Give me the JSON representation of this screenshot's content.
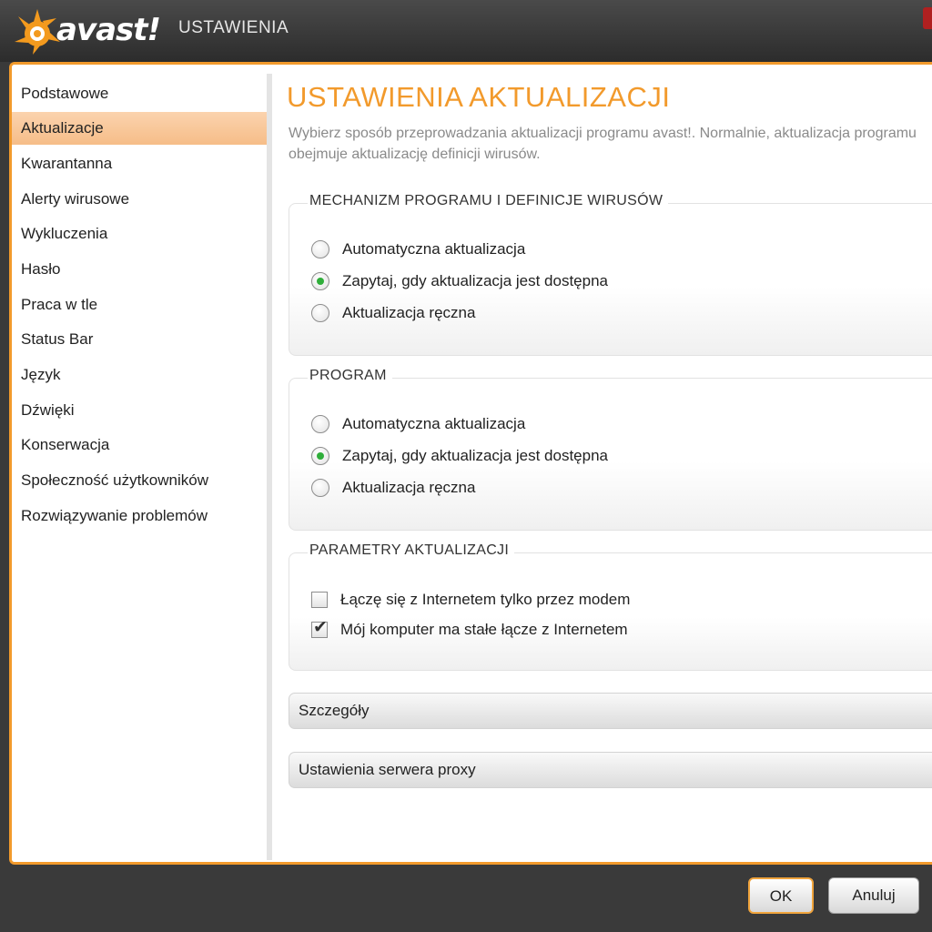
{
  "window": {
    "brand": "avast!",
    "title": "USTAWIENIA"
  },
  "sidebar": {
    "items": [
      {
        "label": "Podstawowe"
      },
      {
        "label": "Aktualizacje"
      },
      {
        "label": "Kwarantanna"
      },
      {
        "label": "Alerty wirusowe"
      },
      {
        "label": "Wykluczenia"
      },
      {
        "label": "Hasło"
      },
      {
        "label": "Praca w tle"
      },
      {
        "label": "Status Bar"
      },
      {
        "label": "Język"
      },
      {
        "label": "Dźwięki"
      },
      {
        "label": "Konserwacja"
      },
      {
        "label": "Społeczność użytkowników"
      },
      {
        "label": "Rozwiązywanie problemów"
      }
    ],
    "active_index": 1
  },
  "main": {
    "title": "USTAWIENIA AKTUALIZACJI",
    "description": "Wybierz sposób przeprowadzania aktualizacji programu avast!. Normalnie, aktualizacja programu obejmuje aktualizację definicji wirusów.",
    "groups": [
      {
        "title": "MECHANIZM PROGRAMU I DEFINICJE WIRUSÓW",
        "options": [
          {
            "label": "Automatyczna aktualizacja",
            "selected": false
          },
          {
            "label": "Zapytaj, gdy aktualizacja jest dostępna",
            "selected": true
          },
          {
            "label": "Aktualizacja ręczna",
            "selected": false
          }
        ]
      },
      {
        "title": "PROGRAM",
        "options": [
          {
            "label": "Automatyczna aktualizacja",
            "selected": false
          },
          {
            "label": "Zapytaj, gdy aktualizacja jest dostępna",
            "selected": true
          },
          {
            "label": "Aktualizacja ręczna",
            "selected": false
          }
        ]
      },
      {
        "title": "PARAMETRY AKTUALIZACJI",
        "checkboxes": [
          {
            "label": "Łączę się z Internetem tylko przez modem",
            "checked": false
          },
          {
            "label": "Mój komputer ma stałe łącze z Internetem",
            "checked": true
          }
        ]
      }
    ],
    "sections": [
      {
        "label": "Szczegóły"
      },
      {
        "label": "Ustawienia serwera proxy"
      }
    ]
  },
  "footer": {
    "ok_label": "OK",
    "cancel_label": "Anuluj"
  },
  "colors": {
    "accent": "#f29a2c",
    "selected_item": "#f8c797",
    "radio_dot": "#2fae3a"
  }
}
